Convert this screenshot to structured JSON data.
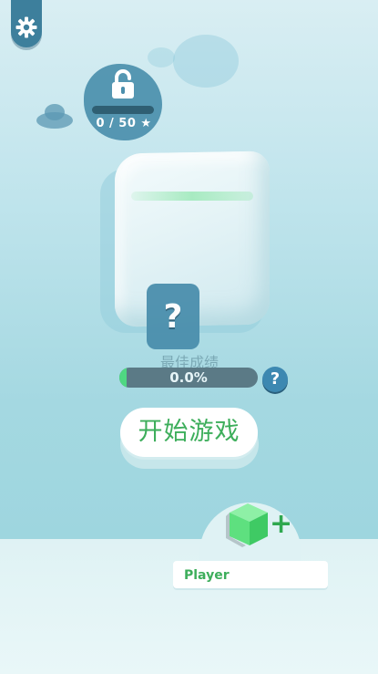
{
  "settings": {
    "icon": "gear-icon"
  },
  "lock_badge": {
    "icon": "unlock-icon",
    "stars_text": "0 / 50",
    "star_icon": "★",
    "progress": 0
  },
  "cube": {
    "mystery_symbol": "?"
  },
  "best_score": {
    "label": "最佳成绩",
    "value_text": "0.0%",
    "progress": 0.0,
    "help_symbol": "?"
  },
  "start_button": {
    "label": "开始游戏"
  },
  "player": {
    "name": "Player",
    "add_symbol": "+",
    "icon": "green-cube-icon"
  },
  "colors": {
    "accent_green": "#3dae5b",
    "badge_blue": "#4b8fad",
    "progress_green": "#4fd882"
  }
}
